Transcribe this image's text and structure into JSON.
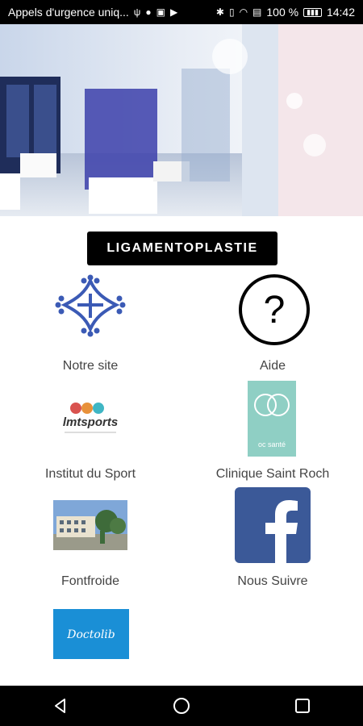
{
  "status_bar": {
    "notification_text": "Appels d'urgence uniq...",
    "battery": "100 %",
    "time": "14:42"
  },
  "header_button": {
    "label": "LIGAMENTOPLASTIE"
  },
  "tiles": [
    {
      "label": "Notre site",
      "icon": "occitan-cross-icon"
    },
    {
      "label": "Aide",
      "icon": "help-icon"
    },
    {
      "label": "Institut du Sport",
      "icon": "imtsports-logo"
    },
    {
      "label": "Clinique Saint Roch",
      "icon": "oc-sante-logo"
    },
    {
      "label": "Fontfroide",
      "icon": "building-photo"
    },
    {
      "label": "Nous Suivre",
      "icon": "facebook-icon"
    },
    {
      "label": "",
      "icon": "doctolib-logo"
    }
  ],
  "logos": {
    "imt_text": "lmtsports",
    "oc_text": "oc santé",
    "doctolib_text": "Doctolib"
  },
  "colors": {
    "accent_blue": "#3b5ab5",
    "facebook_blue": "#3b5998",
    "oc_teal": "#8fcfc4",
    "doctolib_blue": "#1a8fd6"
  }
}
